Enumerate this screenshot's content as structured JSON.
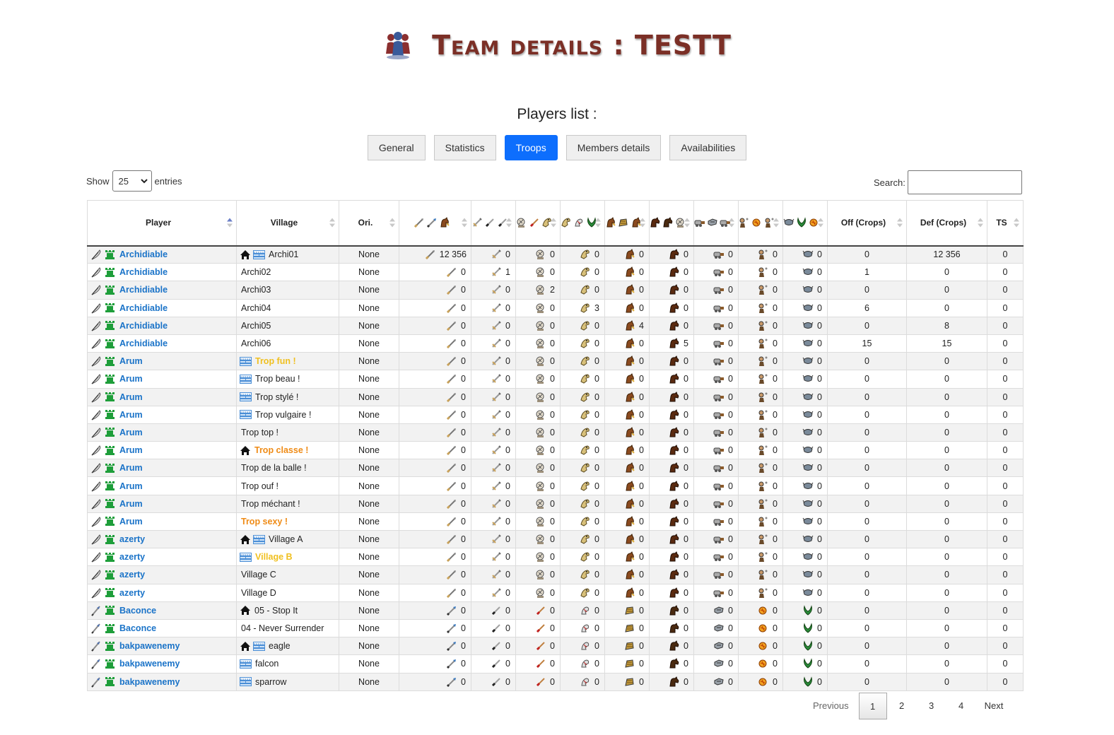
{
  "header": {
    "title": "Team details : TESTT",
    "icon": "team-icon"
  },
  "section_title": "Players list :",
  "tabs": [
    {
      "label": "General",
      "active": false
    },
    {
      "label": "Statistics",
      "active": false
    },
    {
      "label": "Troops",
      "active": true
    },
    {
      "label": "Members details",
      "active": false
    },
    {
      "label": "Availabilities",
      "active": false
    }
  ],
  "length": {
    "show_label": "Show",
    "value": "25",
    "entries_label": "entries"
  },
  "search": {
    "label": "Search:",
    "value": ""
  },
  "columns": [
    "Player",
    "Village",
    "Ori.",
    "",
    "",
    "",
    "",
    "",
    "",
    "",
    "",
    "",
    "Off (Crops)",
    "Def (Crops)",
    "TS"
  ],
  "colors": {
    "link": "#1a73c8",
    "active_tab": "#0d6efd",
    "title": "#7b2f26",
    "capital_highlight": "#f0c020",
    "special_highlight": "#ef8b16"
  },
  "rows": [
    {
      "player": "Archidiable",
      "tribe": "gaul",
      "village": "Archi01",
      "vstyle": "",
      "home": true,
      "wall": true,
      "ori": "None",
      "troops": [
        "12 356",
        "0",
        "0",
        "0",
        "0",
        "0",
        "0",
        "0",
        "0"
      ],
      "off": "0",
      "def": "12 356",
      "ts": "0"
    },
    {
      "player": "Archidiable",
      "tribe": "gaul",
      "village": "Archi02",
      "vstyle": "",
      "home": false,
      "wall": false,
      "ori": "None",
      "troops": [
        "0",
        "1",
        "0",
        "0",
        "0",
        "0",
        "0",
        "0",
        "0"
      ],
      "off": "1",
      "def": "0",
      "ts": "0"
    },
    {
      "player": "Archidiable",
      "tribe": "gaul",
      "village": "Archi03",
      "vstyle": "",
      "home": false,
      "wall": false,
      "ori": "None",
      "troops": [
        "0",
        "0",
        "2",
        "0",
        "0",
        "0",
        "0",
        "0",
        "0"
      ],
      "off": "0",
      "def": "0",
      "ts": "0"
    },
    {
      "player": "Archidiable",
      "tribe": "gaul",
      "village": "Archi04",
      "vstyle": "",
      "home": false,
      "wall": false,
      "ori": "None",
      "troops": [
        "0",
        "0",
        "0",
        "3",
        "0",
        "0",
        "0",
        "0",
        "0"
      ],
      "off": "6",
      "def": "0",
      "ts": "0"
    },
    {
      "player": "Archidiable",
      "tribe": "gaul",
      "village": "Archi05",
      "vstyle": "",
      "home": false,
      "wall": false,
      "ori": "None",
      "troops": [
        "0",
        "0",
        "0",
        "0",
        "4",
        "0",
        "0",
        "0",
        "0"
      ],
      "off": "0",
      "def": "8",
      "ts": "0"
    },
    {
      "player": "Archidiable",
      "tribe": "gaul",
      "village": "Archi06",
      "vstyle": "",
      "home": false,
      "wall": false,
      "ori": "None",
      "troops": [
        "0",
        "0",
        "0",
        "0",
        "0",
        "5",
        "0",
        "0",
        "0"
      ],
      "off": "15",
      "def": "15",
      "ts": "0"
    },
    {
      "player": "Arum",
      "tribe": "gaul",
      "village": "Trop fun !",
      "vstyle": "yellow",
      "home": false,
      "wall": true,
      "ori": "None",
      "troops": [
        "0",
        "0",
        "0",
        "0",
        "0",
        "0",
        "0",
        "0",
        "0"
      ],
      "off": "0",
      "def": "0",
      "ts": "0"
    },
    {
      "player": "Arum",
      "tribe": "gaul",
      "village": "Trop beau !",
      "vstyle": "",
      "home": false,
      "wall": true,
      "ori": "None",
      "troops": [
        "0",
        "0",
        "0",
        "0",
        "0",
        "0",
        "0",
        "0",
        "0"
      ],
      "off": "0",
      "def": "0",
      "ts": "0"
    },
    {
      "player": "Arum",
      "tribe": "gaul",
      "village": "Trop stylé !",
      "vstyle": "",
      "home": false,
      "wall": true,
      "ori": "None",
      "troops": [
        "0",
        "0",
        "0",
        "0",
        "0",
        "0",
        "0",
        "0",
        "0"
      ],
      "off": "0",
      "def": "0",
      "ts": "0"
    },
    {
      "player": "Arum",
      "tribe": "gaul",
      "village": "Trop vulgaire !",
      "vstyle": "",
      "home": false,
      "wall": true,
      "ori": "None",
      "troops": [
        "0",
        "0",
        "0",
        "0",
        "0",
        "0",
        "0",
        "0",
        "0"
      ],
      "off": "0",
      "def": "0",
      "ts": "0"
    },
    {
      "player": "Arum",
      "tribe": "gaul",
      "village": "Trop top !",
      "vstyle": "",
      "home": false,
      "wall": false,
      "ori": "None",
      "troops": [
        "0",
        "0",
        "0",
        "0",
        "0",
        "0",
        "0",
        "0",
        "0"
      ],
      "off": "0",
      "def": "0",
      "ts": "0"
    },
    {
      "player": "Arum",
      "tribe": "gaul",
      "village": "Trop classe !",
      "vstyle": "orange",
      "home": true,
      "wall": false,
      "ori": "None",
      "troops": [
        "0",
        "0",
        "0",
        "0",
        "0",
        "0",
        "0",
        "0",
        "0"
      ],
      "off": "0",
      "def": "0",
      "ts": "0"
    },
    {
      "player": "Arum",
      "tribe": "gaul",
      "village": "Trop de la balle !",
      "vstyle": "",
      "home": false,
      "wall": false,
      "ori": "None",
      "troops": [
        "0",
        "0",
        "0",
        "0",
        "0",
        "0",
        "0",
        "0",
        "0"
      ],
      "off": "0",
      "def": "0",
      "ts": "0"
    },
    {
      "player": "Arum",
      "tribe": "gaul",
      "village": "Trop ouf !",
      "vstyle": "",
      "home": false,
      "wall": false,
      "ori": "None",
      "troops": [
        "0",
        "0",
        "0",
        "0",
        "0",
        "0",
        "0",
        "0",
        "0"
      ],
      "off": "0",
      "def": "0",
      "ts": "0"
    },
    {
      "player": "Arum",
      "tribe": "gaul",
      "village": "Trop méchant !",
      "vstyle": "",
      "home": false,
      "wall": false,
      "ori": "None",
      "troops": [
        "0",
        "0",
        "0",
        "0",
        "0",
        "0",
        "0",
        "0",
        "0"
      ],
      "off": "0",
      "def": "0",
      "ts": "0"
    },
    {
      "player": "Arum",
      "tribe": "gaul",
      "village": "Trop sexy !",
      "vstyle": "orange",
      "home": false,
      "wall": false,
      "ori": "None",
      "troops": [
        "0",
        "0",
        "0",
        "0",
        "0",
        "0",
        "0",
        "0",
        "0"
      ],
      "off": "0",
      "def": "0",
      "ts": "0"
    },
    {
      "player": "azerty",
      "tribe": "gaul",
      "village": "Village A",
      "vstyle": "",
      "home": true,
      "wall": true,
      "ori": "None",
      "troops": [
        "0",
        "0",
        "0",
        "0",
        "0",
        "0",
        "0",
        "0",
        "0"
      ],
      "off": "0",
      "def": "0",
      "ts": "0"
    },
    {
      "player": "azerty",
      "tribe": "gaul",
      "village": "Village B",
      "vstyle": "yellow",
      "home": false,
      "wall": true,
      "ori": "None",
      "troops": [
        "0",
        "0",
        "0",
        "0",
        "0",
        "0",
        "0",
        "0",
        "0"
      ],
      "off": "0",
      "def": "0",
      "ts": "0"
    },
    {
      "player": "azerty",
      "tribe": "gaul",
      "village": "Village C",
      "vstyle": "",
      "home": false,
      "wall": false,
      "ori": "None",
      "troops": [
        "0",
        "0",
        "0",
        "0",
        "0",
        "0",
        "0",
        "0",
        "0"
      ],
      "off": "0",
      "def": "0",
      "ts": "0"
    },
    {
      "player": "azerty",
      "tribe": "gaul",
      "village": "Village D",
      "vstyle": "",
      "home": false,
      "wall": false,
      "ori": "None",
      "troops": [
        "0",
        "0",
        "0",
        "0",
        "0",
        "0",
        "0",
        "0",
        "0"
      ],
      "off": "0",
      "def": "0",
      "ts": "0"
    },
    {
      "player": "Baconce",
      "tribe": "roman",
      "village": "05 - Stop It",
      "vstyle": "",
      "home": true,
      "wall": false,
      "ori": "None",
      "troops": [
        "0",
        "0",
        "0",
        "0",
        "0",
        "0",
        "0",
        "0",
        "0"
      ],
      "off": "0",
      "def": "0",
      "ts": "0"
    },
    {
      "player": "Baconce",
      "tribe": "roman",
      "village": "04 - Never Surrender",
      "vstyle": "",
      "home": false,
      "wall": false,
      "ori": "None",
      "troops": [
        "0",
        "0",
        "0",
        "0",
        "0",
        "0",
        "0",
        "0",
        "0"
      ],
      "off": "0",
      "def": "0",
      "ts": "0"
    },
    {
      "player": "bakpawenemy",
      "tribe": "roman",
      "village": "eagle",
      "vstyle": "",
      "home": true,
      "wall": true,
      "ori": "None",
      "troops": [
        "0",
        "0",
        "0",
        "0",
        "0",
        "0",
        "0",
        "0",
        "0"
      ],
      "off": "0",
      "def": "0",
      "ts": "0"
    },
    {
      "player": "bakpawenemy",
      "tribe": "roman",
      "village": "falcon",
      "vstyle": "",
      "home": false,
      "wall": true,
      "ori": "None",
      "troops": [
        "0",
        "0",
        "0",
        "0",
        "0",
        "0",
        "0",
        "0",
        "0"
      ],
      "off": "0",
      "def": "0",
      "ts": "0"
    },
    {
      "player": "bakpawenemy",
      "tribe": "roman",
      "village": "sparrow",
      "vstyle": "",
      "home": false,
      "wall": true,
      "ori": "None",
      "troops": [
        "0",
        "0",
        "0",
        "0",
        "0",
        "0",
        "0",
        "0",
        "0"
      ],
      "off": "0",
      "def": "0",
      "ts": "0"
    }
  ],
  "pagination": {
    "previous": "Previous",
    "pages": [
      "1",
      "2",
      "3",
      "4"
    ],
    "current": "1",
    "next": "Next"
  }
}
